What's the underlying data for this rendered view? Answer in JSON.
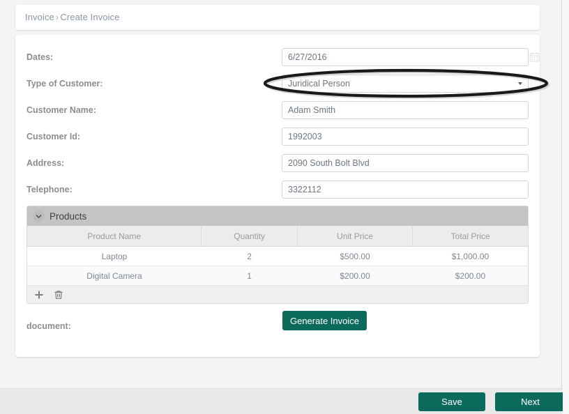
{
  "breadcrumb": {
    "root": "Invoice",
    "separator": "›",
    "current": "Create Invoice"
  },
  "form": {
    "rows": [
      {
        "label": "Dates:",
        "value": "6/27/2016",
        "icon": "calendar-icon"
      },
      {
        "label": "Type of Customer:",
        "value": "Juridical Person",
        "icon": "chevron-down-icon"
      },
      {
        "label": "Customer Name:",
        "value": "Adam Smith",
        "icon": ""
      },
      {
        "label": "Customer Id:",
        "value": "1992003",
        "icon": ""
      },
      {
        "label": "Address:",
        "value": "2090 South Bolt Blvd",
        "icon": ""
      },
      {
        "label": "Telephone:",
        "value": "3322112",
        "icon": ""
      }
    ],
    "customer_type_options": [
      "Juridical Person"
    ]
  },
  "products": {
    "panel_title": "Products",
    "collapse_icon": "chevron-down-icon",
    "columns": [
      "Product Name",
      "Quantity",
      "Unit Price",
      "Total Price"
    ],
    "rows": [
      {
        "name": "Laptop",
        "quantity": "2",
        "unit_price": "$500.00",
        "total_price": "$1,000.00"
      },
      {
        "name": "Digital Camera",
        "quantity": "1",
        "unit_price": "$200.00",
        "total_price": "$200.00"
      }
    ],
    "toolbar": {
      "add_icon": "plus-icon",
      "delete_icon": "trash-icon"
    }
  },
  "document": {
    "label": "document:",
    "generate_button": "Generate Invoice"
  },
  "footer": {
    "save_label": "Save",
    "next_label": "Next"
  },
  "colors": {
    "accent_teal": "#0c6a5c",
    "label_gray": "#8d8d8d",
    "value_gray": "#6f7782",
    "panel_header_gray": "#c4c4c4",
    "page_background": "#f4f4f4",
    "annotation_black": "#1a1a1a"
  }
}
